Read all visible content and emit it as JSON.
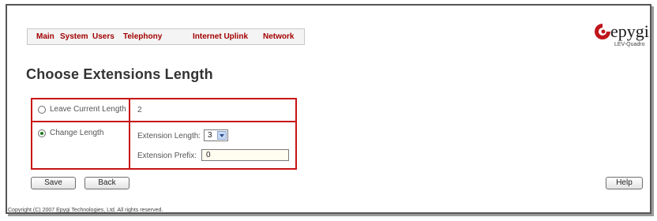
{
  "menu": {
    "items": [
      {
        "label": "Main"
      },
      {
        "label": "System"
      },
      {
        "label": "Users"
      },
      {
        "label": "Telephony"
      },
      {
        "label": "Internet Uplink"
      },
      {
        "label": "Network"
      }
    ]
  },
  "logo": {
    "text": "epygi",
    "subtitle": "LEV-Quadro"
  },
  "page": {
    "title": "Choose Extensions Length"
  },
  "options": {
    "leave_current": {
      "label": "Leave Current Length",
      "value": "2",
      "selected": false
    },
    "change_length": {
      "label": "Change Length",
      "selected": true,
      "extension_length_label": "Extension Length:",
      "extension_length_value": "3",
      "extension_prefix_label": "Extension Prefix:",
      "extension_prefix_value": "0"
    }
  },
  "buttons": {
    "save": "Save",
    "back": "Back",
    "help": "Help"
  },
  "footer": {
    "prefix": "Copyright (C) 2007",
    "link": "Epygi Technologies, Ltd.",
    "suffix": "All rights reserved."
  },
  "colors": {
    "menu_text": "#a30000",
    "row_border": "#c81414",
    "radio_selected": "#1a7a1a",
    "logo_red": "#c0161c"
  }
}
